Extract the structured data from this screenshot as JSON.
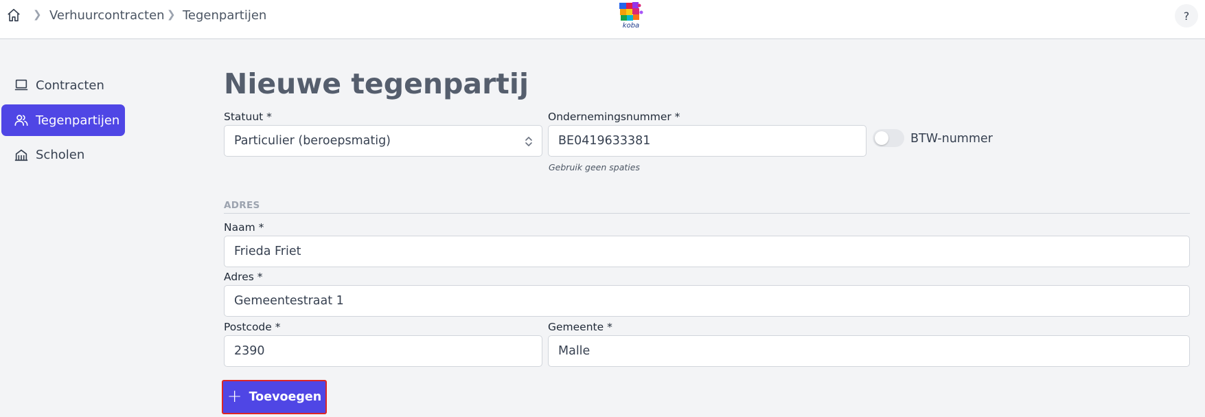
{
  "topbar": {
    "breadcrumbs": [
      "Verhuurcontracten",
      "Tegenpartijen"
    ],
    "logo_text": "koba",
    "help_label": "?"
  },
  "sidebar": {
    "items": [
      {
        "label": "Contracten",
        "icon": "computer-icon",
        "active": false
      },
      {
        "label": "Tegenpartijen",
        "icon": "users-icon",
        "active": true
      },
      {
        "label": "Scholen",
        "icon": "building-icon",
        "active": false
      }
    ]
  },
  "form": {
    "title": "Nieuwe tegenpartij",
    "statuut": {
      "label": "Statuut *",
      "value": "Particulier (beroepsmatig)"
    },
    "ondernemingsnummer": {
      "label": "Ondernemingsnummer *",
      "value": "BE0419633381",
      "hint": "Gebruik geen spaties"
    },
    "btw_toggle": {
      "label": "BTW-nummer",
      "on": false
    },
    "address_section": "ADRES",
    "naam": {
      "label": "Naam *",
      "value": "Frieda Friet"
    },
    "adres": {
      "label": "Adres *",
      "value": "Gemeentestraat 1"
    },
    "postcode": {
      "label": "Postcode *",
      "value": "2390"
    },
    "gemeente": {
      "label": "Gemeente *",
      "value": "Malle"
    },
    "submit_label": "Toevoegen"
  },
  "colors": {
    "accent": "#4f46e5",
    "highlight_border": "#dc2626",
    "background": "#f3f4f6"
  }
}
